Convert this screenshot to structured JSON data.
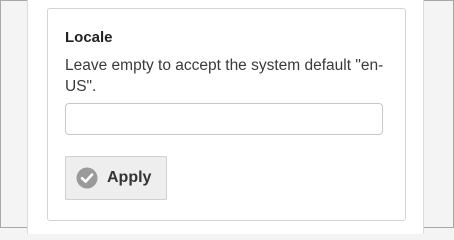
{
  "locale_section": {
    "heading": "Locale",
    "description": "Leave empty to accept the system default \"en-US\".",
    "input": {
      "value": "",
      "placeholder": ""
    },
    "apply_button": {
      "label": "Apply",
      "icon": "check-circle-icon"
    }
  }
}
